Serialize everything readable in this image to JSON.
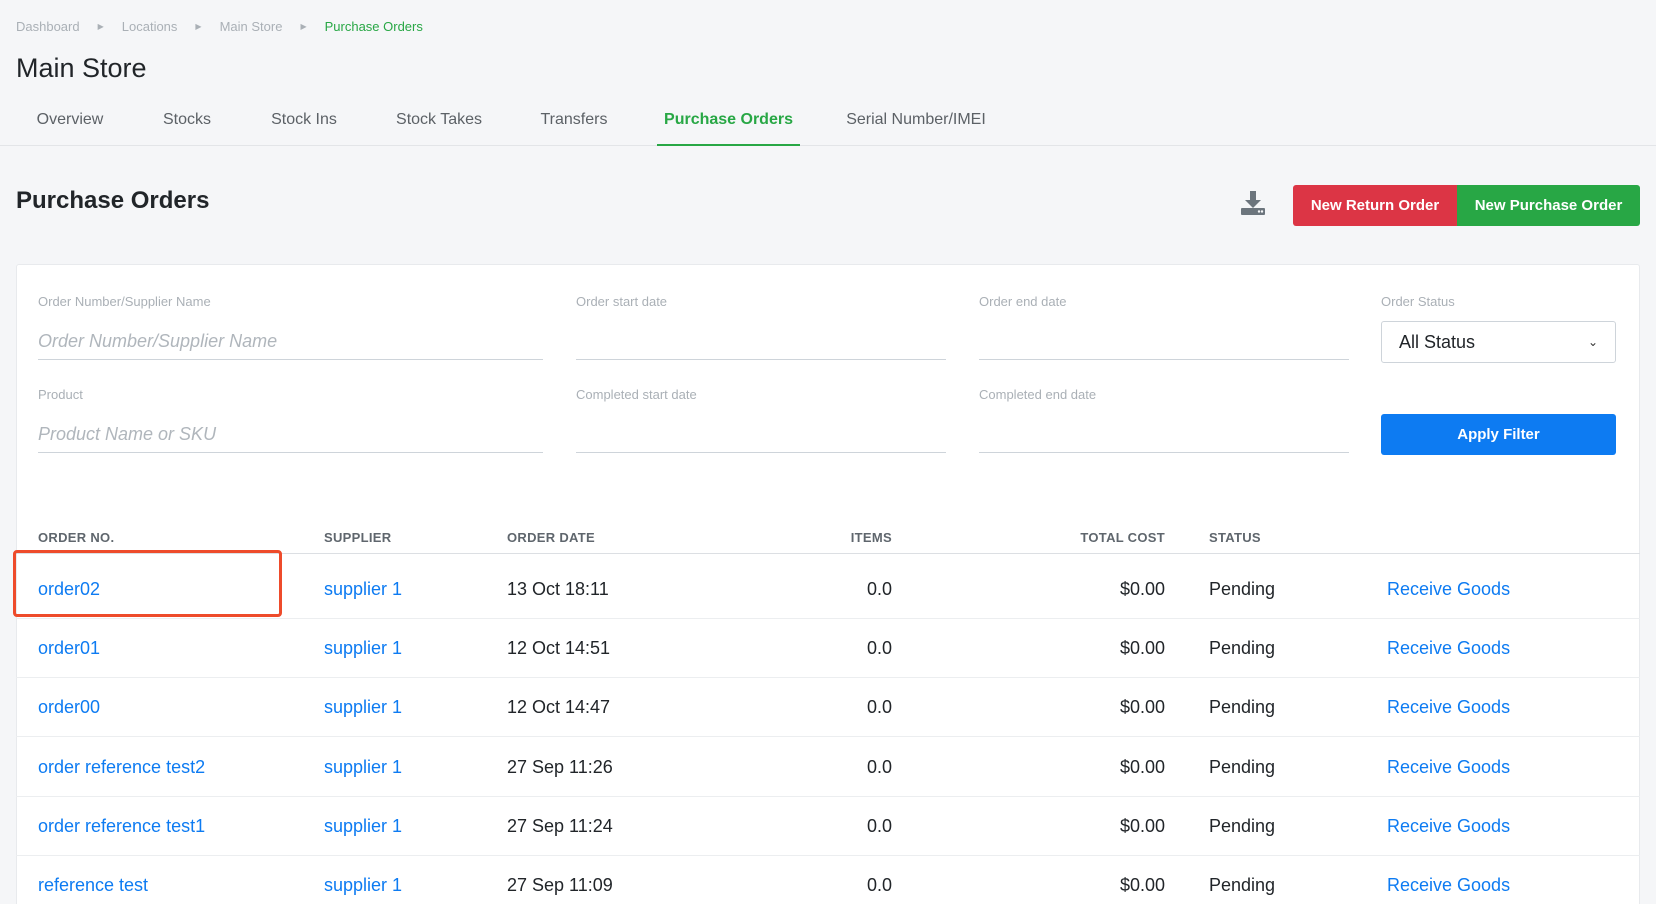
{
  "breadcrumb": [
    {
      "label": "Dashboard"
    },
    {
      "label": "Locations"
    },
    {
      "label": "Main Store"
    },
    {
      "label": "Purchase Orders"
    }
  ],
  "page_title": "Main Store",
  "tabs": [
    {
      "label": "Overview"
    },
    {
      "label": "Stocks"
    },
    {
      "label": "Stock Ins"
    },
    {
      "label": "Stock Takes"
    },
    {
      "label": "Transfers"
    },
    {
      "label": "Purchase Orders",
      "active": true
    },
    {
      "label": "Serial Number/IMEI"
    }
  ],
  "section_title": "Purchase Orders",
  "icons": {
    "download": "download-icon"
  },
  "buttons": {
    "new_return_order": "New Return Order",
    "new_purchase_order": "New Purchase Order",
    "apply_filter": "Apply Filter"
  },
  "filters": {
    "order_search": {
      "label": "Order Number/Supplier Name",
      "placeholder": "Order Number/Supplier Name"
    },
    "order_start": {
      "label": "Order start date"
    },
    "order_end": {
      "label": "Order end date"
    },
    "order_status": {
      "label": "Order Status",
      "value": "All Status"
    },
    "product": {
      "label": "Product",
      "placeholder": "Product Name or SKU"
    },
    "completed_start": {
      "label": "Completed start date"
    },
    "completed_end": {
      "label": "Completed end date"
    }
  },
  "table": {
    "headers": {
      "order_no": "ORDER NO.",
      "supplier": "SUPPLIER",
      "order_date": "ORDER DATE",
      "items": "ITEMS",
      "total_cost": "TOTAL COST",
      "status": "STATUS"
    },
    "rows": [
      {
        "order": "order02",
        "supplier": "supplier 1",
        "date": "13 Oct 18:11",
        "items": "0.0",
        "cost": "$0.00",
        "status": "Pending",
        "action": "Receive Goods"
      },
      {
        "order": "order01",
        "supplier": "supplier 1",
        "date": "12 Oct 14:51",
        "items": "0.0",
        "cost": "$0.00",
        "status": "Pending",
        "action": "Receive Goods"
      },
      {
        "order": "order00",
        "supplier": "supplier 1",
        "date": "12 Oct 14:47",
        "items": "0.0",
        "cost": "$0.00",
        "status": "Pending",
        "action": "Receive Goods"
      },
      {
        "order": "order reference test2",
        "supplier": "supplier 1",
        "date": "27 Sep 11:26",
        "items": "0.0",
        "cost": "$0.00",
        "status": "Pending",
        "action": "Receive Goods"
      },
      {
        "order": "order reference test1",
        "supplier": "supplier 1",
        "date": "27 Sep 11:24",
        "items": "0.0",
        "cost": "$0.00",
        "status": "Pending",
        "action": "Receive Goods"
      },
      {
        "order": "reference test",
        "supplier": "supplier 1",
        "date": "27 Sep 11:09",
        "items": "0.0",
        "cost": "$0.00",
        "status": "Pending",
        "action": "Receive Goods"
      }
    ]
  },
  "colors": {
    "accent_green": "#28a745",
    "danger_red": "#dc3545",
    "primary_blue": "#0d7bf2",
    "highlight_border": "#ee4b2b"
  }
}
